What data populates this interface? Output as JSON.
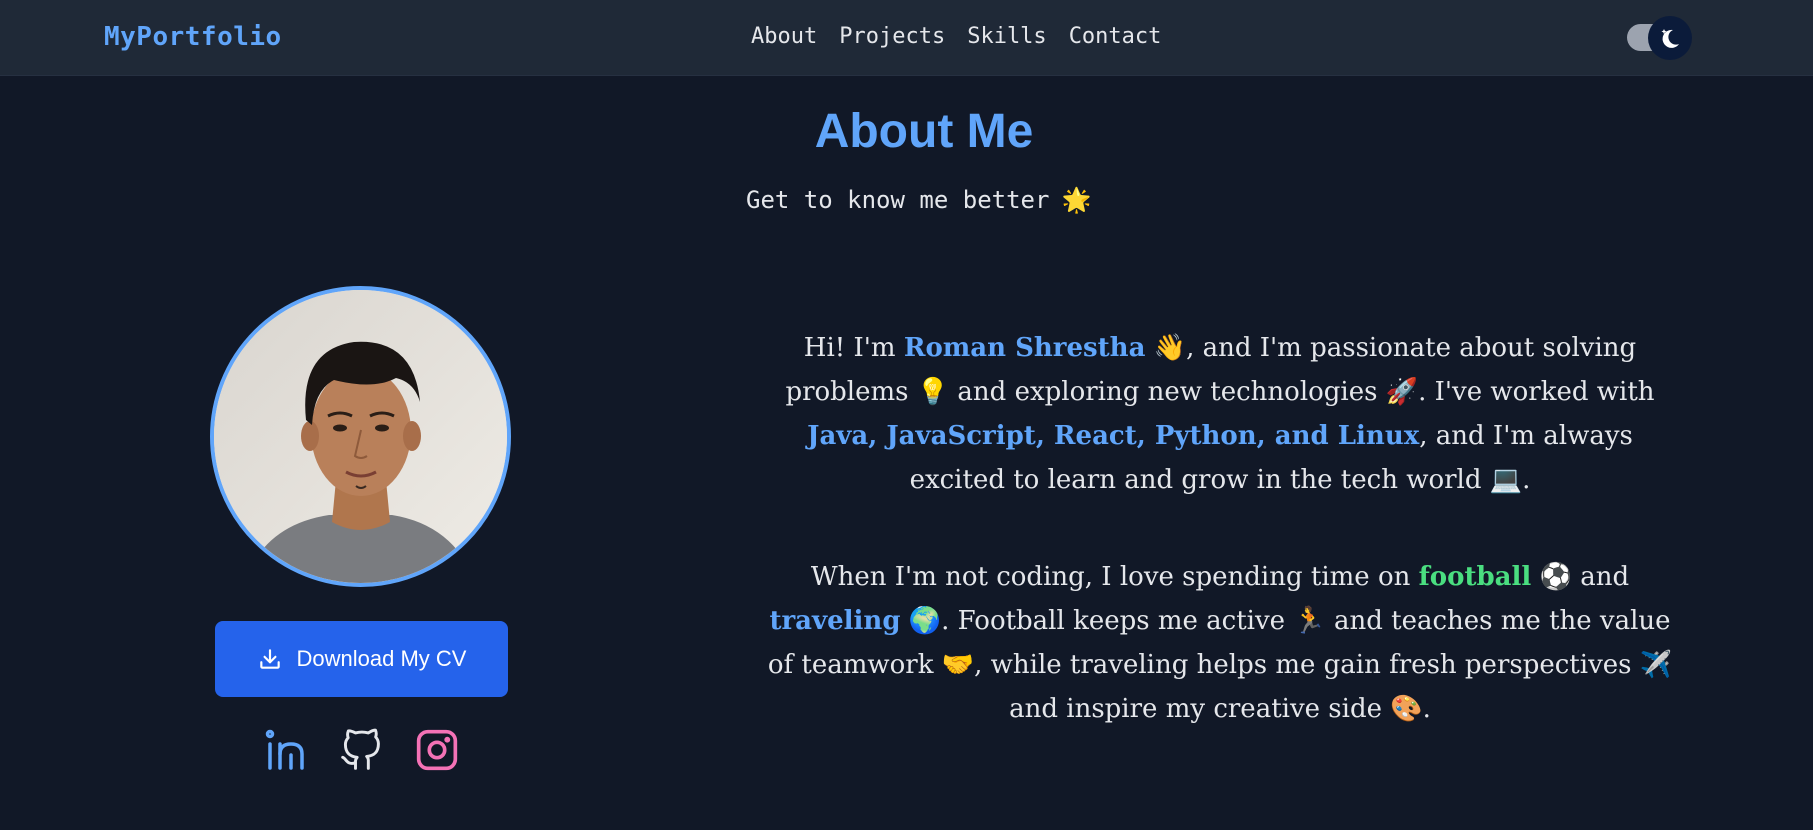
{
  "nav": {
    "brand": "MyPortfolio",
    "links": [
      "About",
      "Projects",
      "Skills",
      "Contact"
    ],
    "theme_toggle": "dark"
  },
  "header": {
    "title": "About Me",
    "subtitle": "Get to know me better",
    "subtitle_emoji": "🌟"
  },
  "profile": {
    "photo_alt": "profile-photo",
    "cv_label": "Download My CV",
    "socials": [
      "linkedin-icon",
      "github-icon",
      "instagram-icon"
    ]
  },
  "about": {
    "p1_a": "Hi! I'm ",
    "name": "Roman Shrestha",
    "p1_b": " 👋, and I'm passionate about solving problems 💡 and exploring new technologies 🚀. I've worked with ",
    "skills": "Java, JavaScript, React, Python, and Linux",
    "p1_c": ", and I'm always excited to learn and grow in the tech world 💻.",
    "p2_a": "When I'm not coding, I love spending time on ",
    "hobby1": "football",
    "p2_b": " ⚽ and ",
    "hobby2": "traveling",
    "p2_c": " 🌍. Football keeps me active 🏃 and teaches me the value of teamwork 🤝, while traveling helps me gain fresh perspectives ✈️ and inspire my creative side 🎨."
  },
  "colors": {
    "accent": "#60a5fa",
    "button": "#2563eb",
    "green": "#4ade80",
    "instagram": "#f472b6",
    "background": "#111827",
    "navbar": "#1f2937"
  }
}
